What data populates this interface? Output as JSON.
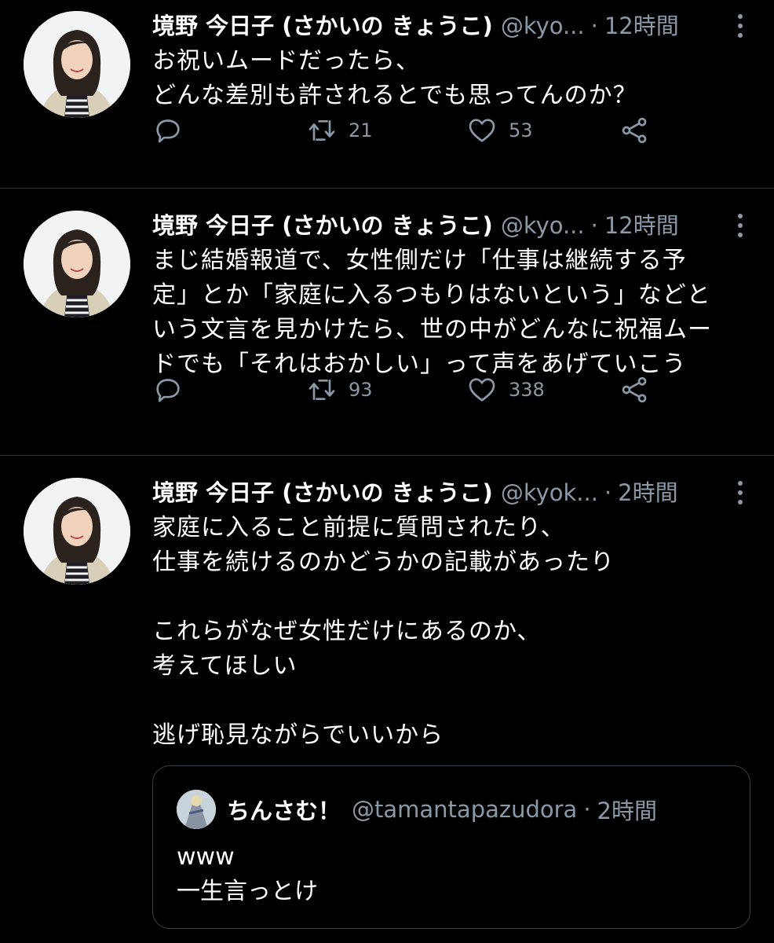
{
  "tweets": [
    {
      "name": "境野 今日子 (さかいの きょうこ)",
      "handle": "@kyo...",
      "time": "12時間",
      "text": "お祝いムードだったら、\nどんな差別も許されるとでも思ってんのか？",
      "retweets": "21",
      "likes": "53"
    },
    {
      "name": "境野 今日子 (さかいの きょうこ)",
      "handle": "@kyo...",
      "time": "12時間",
      "text": "まじ結婚報道で、女性側だけ「仕事は継続する予\n定」とか「家庭に入るつもりはないという」などと\nいう文言を見かけたら、世の中がどんなに祝福ムー\nドでも「それはおかしい」って声をあげていこう",
      "retweets": "93",
      "likes": "338"
    },
    {
      "name": "境野 今日子 (さかいの きょうこ)",
      "handle": "@kyok...",
      "time": "2時間",
      "text": "家庭に入ること前提に質問されたり、\n仕事を続けるのかどうかの記載があったり\n\nこれらがなぜ女性だけにあるのか、\n考えてほしい\n\n逃げ恥見ながらでいいから",
      "quote": {
        "name": "ちんさむ！",
        "handle": "@tamantapazudora",
        "time": "2時間",
        "text": "www\n一生言っとけ"
      }
    }
  ],
  "separator": "·",
  "icons": {
    "reply": "reply-icon",
    "retweet": "retweet-icon",
    "like": "heart-icon",
    "share": "share-icon",
    "more": "more-vertical-icon"
  },
  "colors": {
    "background": "#000000",
    "secondary_text": "#8b98a5",
    "divider": "#2f3336"
  }
}
